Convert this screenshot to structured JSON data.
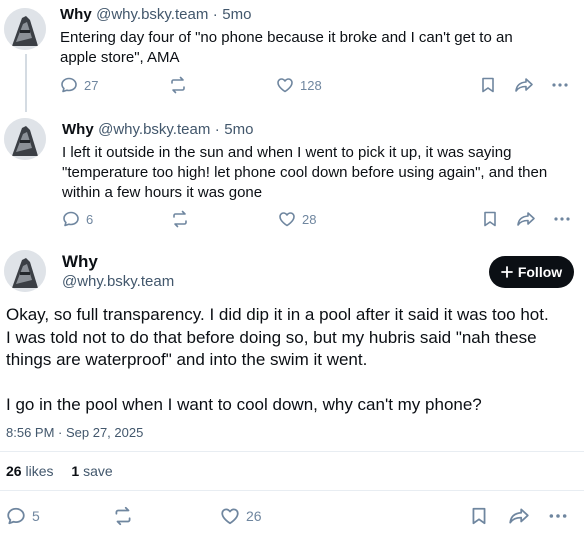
{
  "posts": [
    {
      "author": "Why",
      "handle": "@why.bsky.team",
      "time_sep": "·",
      "time": "5mo",
      "lines": [
        "Entering day four of \"no phone because it broke and I can't get to an",
        "apple store\", AMA"
      ],
      "replies": "27",
      "likes": "128"
    },
    {
      "author": "Why",
      "handle": "@why.bsky.team",
      "time_sep": "·",
      "time": "5mo",
      "lines": [
        "I left it outside in the sun and when I went to pick it up, it was saying",
        "\"temperature too high! let phone cool down before using again\", and then",
        "within a few hours it was gone"
      ],
      "replies": "6",
      "likes": "28"
    }
  ],
  "main": {
    "author": "Why",
    "handle": "@why.bsky.team",
    "follow_label": "Follow",
    "lines": [
      "Okay, so full transparency. I did dip it in a pool after it said it was too hot.",
      "I was told not to do that before doing so, but my hubris said \"nah these",
      "things are waterproof\" and into the swim it went."
    ],
    "line2": "I go in the pool when I want to cool down, why can't my phone?",
    "timestamp": "8:56 PM · Sep 27, 2025",
    "likes_count": "26",
    "likes_label": "likes",
    "saves_count": "1",
    "saves_label": "save",
    "replies": "5",
    "likes": "26"
  },
  "icons": [
    "reply-icon",
    "repost-icon",
    "like-icon",
    "bookmark-icon",
    "share-icon",
    "more-icon",
    "plus-icon"
  ],
  "colors": {
    "muted": "#6f869f",
    "text": "#0b0f14",
    "button": "#0b0f14",
    "divider": "#e8edf2"
  }
}
